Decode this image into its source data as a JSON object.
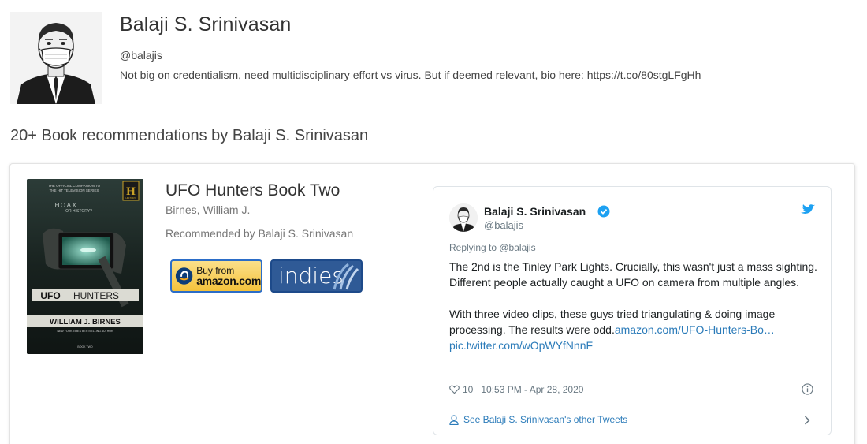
{
  "profile": {
    "name": "Balaji S. Srinivasan",
    "handle": "@balajis",
    "bio": "Not big on credentialism, need multidisciplinary effort vs virus. But if deemed relevant, bio here: https://t.co/80stgLFgHh"
  },
  "section": {
    "heading": "20+ Book recommendations by Balaji S. Srinivasan"
  },
  "book": {
    "title": "UFO Hunters Book Two",
    "author": "Birnes, William J.",
    "recommended_by": "Recommended by Balaji S. Srinivasan",
    "cover": {
      "series_line1": "THE OFFICIAL COMPANION TO",
      "series_line2": "THE HIT TELEVISION SERIES",
      "network": "H",
      "network_sub": "HISTORY",
      "tagline1": "HOAX",
      "tagline2": "OR HISTORY?",
      "title_bold": "UFO",
      "title_rest": "HUNTERS",
      "author": "WILLIAM J. BIRNES",
      "author_sub": "NEW YORK TIMES BESTSELLING AUTHOR",
      "footer": "BOOK TWO"
    },
    "buttons": {
      "amazon_line1": "Buy from",
      "amazon_line2": "amazon.com",
      "indies": "indies"
    }
  },
  "tweet": {
    "name": "Balaji S. Srinivasan",
    "handle": "@balajis",
    "replying": "Replying to @balajis",
    "body_p1": "The 2nd is the Tinley Park Lights. Crucially, this wasn't just a mass sighting. Different people actually caught a UFO on camera from multiple angles.",
    "body_p2": "With three video clips, these guys tried triangulating & doing image processing. The results were odd.",
    "link1": "amazon.com/UFO-Hunters-Bo…",
    "link2": "pic.twitter.com/wOpWYfNnnF",
    "likes": "10",
    "timestamp": "10:53 PM - Apr 28, 2020",
    "other_tweets": "See Balaji S. Srinivasan's other Tweets"
  },
  "colors": {
    "link": "#2b7bb9",
    "twitter_blue": "#1da1f2",
    "amazon_yellow": "#f4c23b",
    "indies_blue": "#2f5a96"
  }
}
